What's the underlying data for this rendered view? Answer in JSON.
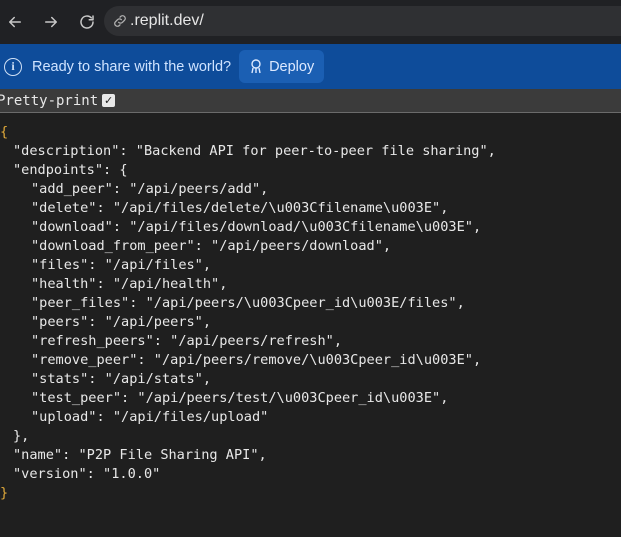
{
  "browser": {
    "url": ".replit.dev/"
  },
  "banner": {
    "message": "Ready to share with the world?",
    "deploy_label": "Deploy"
  },
  "toolbar": {
    "pretty_print_label": "Pretty-print",
    "pretty_print_checked": true
  },
  "json": {
    "open_brace": "{",
    "close_brace": "}",
    "description_line": "\"description\": \"Backend API for peer-to-peer file sharing\",",
    "endpoints_open": "\"endpoints\": {",
    "endpoints": [
      "\"add_peer\": \"/api/peers/add\",",
      "\"delete\": \"/api/files/delete/\\u003Cfilename\\u003E\",",
      "\"download\": \"/api/files/download/\\u003Cfilename\\u003E\",",
      "\"download_from_peer\": \"/api/peers/download\",",
      "\"files\": \"/api/files\",",
      "\"health\": \"/api/health\",",
      "\"peer_files\": \"/api/peers/\\u003Cpeer_id\\u003E/files\",",
      "\"peers\": \"/api/peers\",",
      "\"refresh_peers\": \"/api/peers/refresh\",",
      "\"remove_peer\": \"/api/peers/remove/\\u003Cpeer_id\\u003E\",",
      "\"stats\": \"/api/stats\",",
      "\"test_peer\": \"/api/peers/test/\\u003Cpeer_id\\u003E\",",
      "\"upload\": \"/api/files/upload\""
    ],
    "endpoints_close": "},",
    "name_line": "\"name\": \"P2P File Sharing API\",",
    "version_line": "\"version\": \"1.0.0\""
  }
}
